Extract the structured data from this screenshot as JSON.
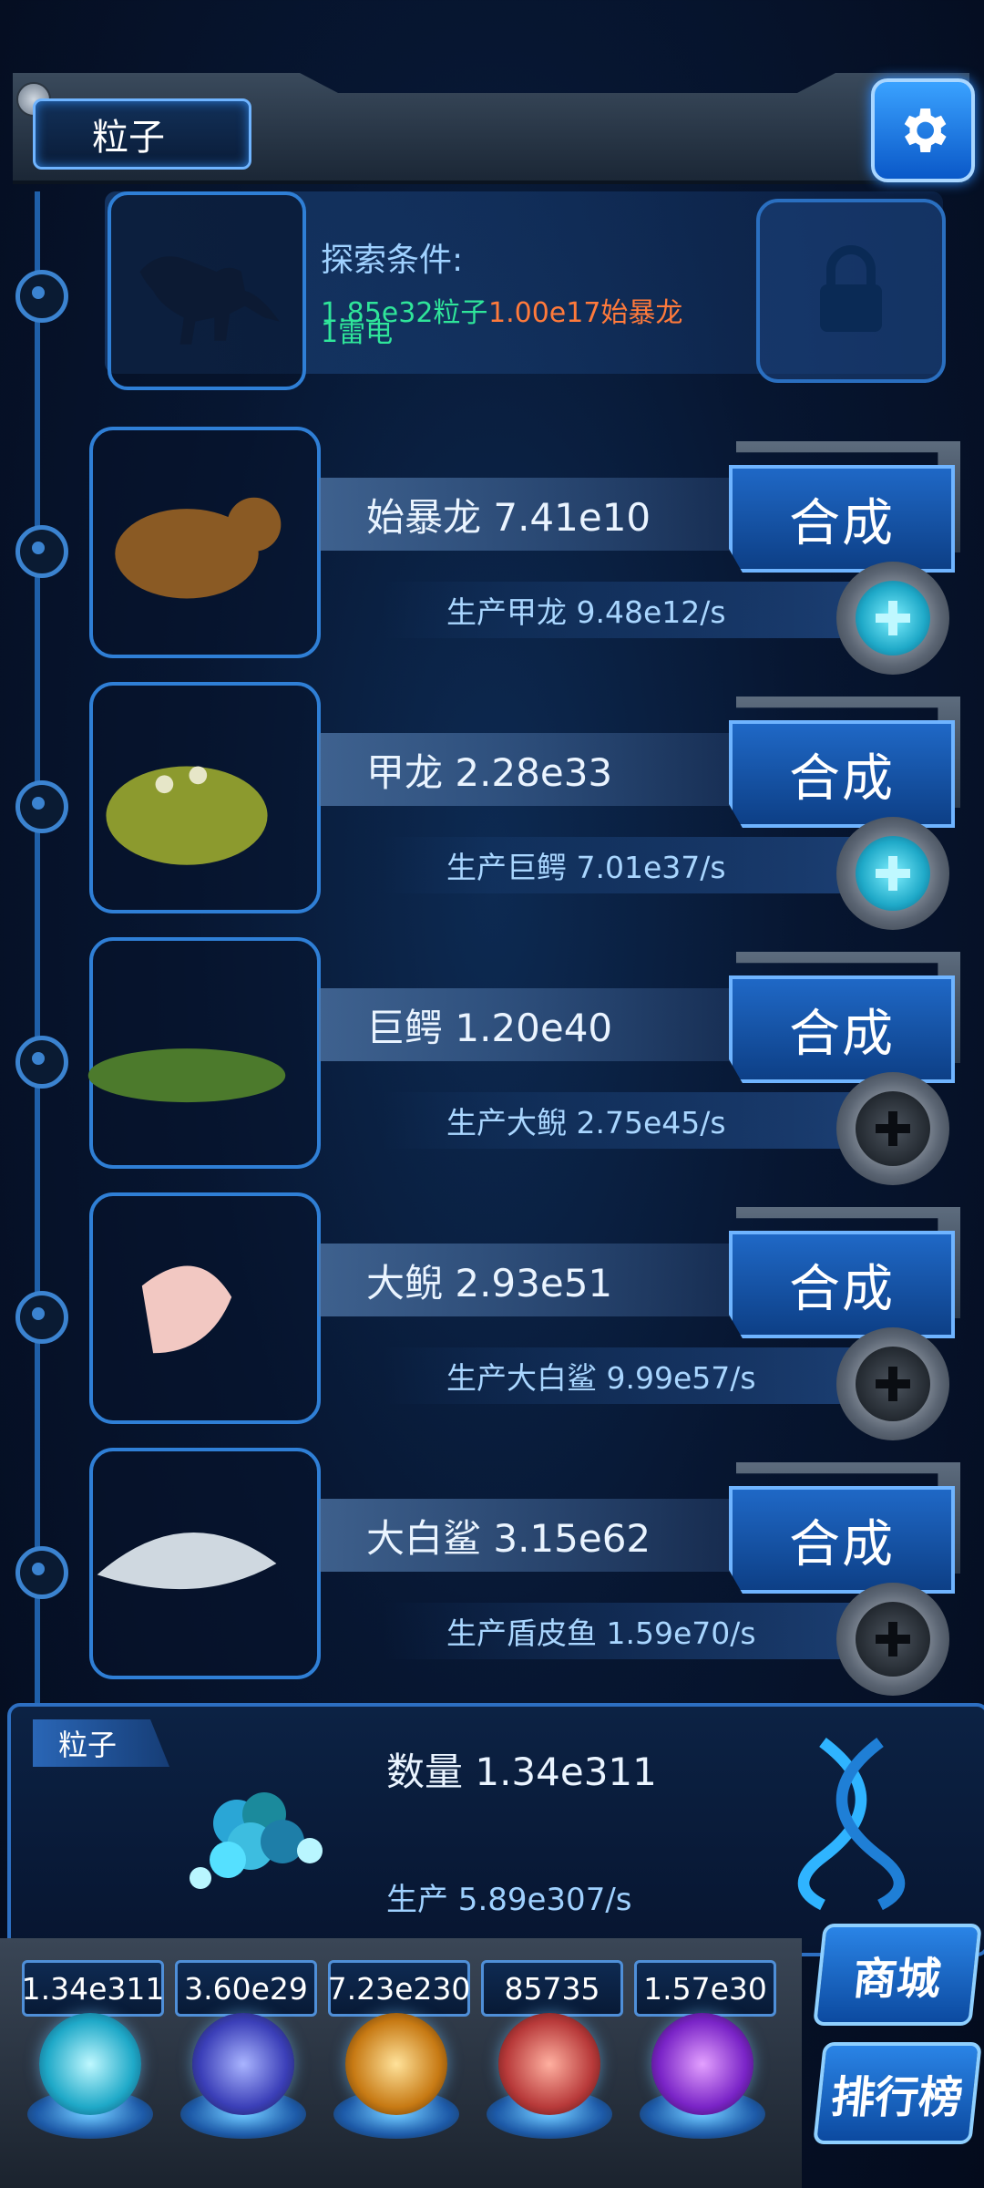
{
  "header": {
    "title": "粒子",
    "settings_icon": "gear-icon"
  },
  "explore": {
    "label": "探索条件:",
    "cost_particle": "1.85e32粒子",
    "cost_dino": "1.00e17始暴龙",
    "cost_lei": "1雷电",
    "lock_icon": "lock-icon"
  },
  "creatures": [
    {
      "name": "始暴龙 7.41e10",
      "production": "生产甲龙 9.48e12/s",
      "synth_label": "合成",
      "plus_active": true
    },
    {
      "name": "甲龙 2.28e33",
      "production": "生产巨鳄 7.01e37/s",
      "synth_label": "合成",
      "plus_active": true
    },
    {
      "name": "巨鳄 1.20e40",
      "production": "生产大鲵 2.75e45/s",
      "synth_label": "合成",
      "plus_active": false
    },
    {
      "name": "大鲵 2.93e51",
      "production": "生产大白鲨 9.99e57/s",
      "synth_label": "合成",
      "plus_active": false
    },
    {
      "name": "大白鲨 3.15e62",
      "production": "生产盾皮鱼 1.59e70/s",
      "synth_label": "合成",
      "plus_active": false
    }
  ],
  "particle": {
    "tag": "粒子",
    "count": "数量 1.34e311",
    "production": "生产 5.89e307/s"
  },
  "resources": [
    {
      "value": "1.34e311",
      "orb": "particle-orb"
    },
    {
      "value": "3.60e29",
      "orb": "lightning-orb"
    },
    {
      "value": "7.23e230",
      "orb": "fire-orb"
    },
    {
      "value": "85735",
      "orb": "brain-orb"
    },
    {
      "value": "1.57e30",
      "orb": "vortex-orb"
    }
  ],
  "side_buttons": {
    "shop": "商城",
    "ranking": "排行榜"
  },
  "colors": {
    "accent": "#2f7fd6",
    "cost_green": "#2fe59a",
    "cost_orange": "#ff7a3b",
    "plus_active": "#1fa9c8"
  }
}
